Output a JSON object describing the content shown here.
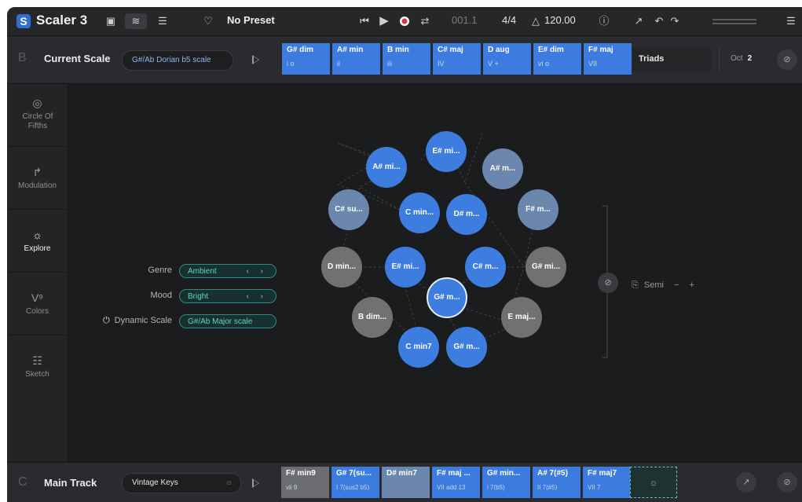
{
  "app": {
    "logo_letter": "S",
    "title": "Scaler 3"
  },
  "topbar": {
    "preset_label": "No Preset",
    "position": "001.1",
    "time_signature": "4/4",
    "tempo": "120.00"
  },
  "scale_row": {
    "letter": "B",
    "title": "Current Scale",
    "scale_name": "G#/Ab Dorian b5 scale",
    "chords": [
      {
        "name": "G# dim",
        "roman": "i o"
      },
      {
        "name": "A# min",
        "roman": "ii"
      },
      {
        "name": "B min",
        "roman": "iii"
      },
      {
        "name": "C# maj",
        "roman": "IV"
      },
      {
        "name": "D aug",
        "roman": "V +"
      },
      {
        "name": "E# dim",
        "roman": "vi o"
      },
      {
        "name": "F# maj",
        "roman": "VII"
      }
    ],
    "chord_type": "Triads",
    "oct_label": "Oct",
    "oct_value": "2"
  },
  "sidebar": {
    "items": [
      {
        "label": "Circle Of Fifths",
        "icon": "target-icon"
      },
      {
        "label": "Modulation",
        "icon": "modulation-icon"
      },
      {
        "label": "Explore",
        "icon": "lightbulb-icon"
      },
      {
        "label": "Colors",
        "icon": "colors-icon"
      },
      {
        "label": "Sketch",
        "icon": "sketch-icon"
      }
    ]
  },
  "explore": {
    "genre_label": "Genre",
    "genre_value": "Ambient",
    "mood_label": "Mood",
    "mood_value": "Bright",
    "dynamic_label": "Dynamic Scale",
    "dynamic_value": "G#/Ab Major scale",
    "semi_label": "Semi",
    "nodes": [
      {
        "label": "E# mi...",
        "color": "blue"
      },
      {
        "label": "A# mi...",
        "color": "blue"
      },
      {
        "label": "A# m...",
        "color": "slate"
      },
      {
        "label": "C# su...",
        "color": "slate"
      },
      {
        "label": "C min...",
        "color": "blue"
      },
      {
        "label": "D# m...",
        "color": "blue"
      },
      {
        "label": "F# m...",
        "color": "slate"
      },
      {
        "label": "D min...",
        "color": "grey"
      },
      {
        "label": "E# mi...",
        "color": "blue"
      },
      {
        "label": "C# m...",
        "color": "blue"
      },
      {
        "label": "G# mi...",
        "color": "grey"
      },
      {
        "label": "G# m...",
        "color": "selected"
      },
      {
        "label": "B dim...",
        "color": "grey"
      },
      {
        "label": "E maj...",
        "color": "grey"
      },
      {
        "label": "C min7",
        "color": "blue"
      },
      {
        "label": "G# m...",
        "color": "blue"
      }
    ]
  },
  "track_row": {
    "letter": "C",
    "title": "Main Track",
    "instrument": "Vintage Keys",
    "chords": [
      {
        "name": "F# min9",
        "roman": "vii 9",
        "color": "grey"
      },
      {
        "name": "G# 7(su...",
        "roman": "I 7(sus2 b5)",
        "color": "blue"
      },
      {
        "name": "D# min7",
        "roman": "",
        "color": "slate"
      },
      {
        "name": "F# maj ...",
        "roman": "VII add 13",
        "color": "blue"
      },
      {
        "name": "G# min...",
        "roman": "i 7(b5)",
        "color": "blue"
      },
      {
        "name": "A# 7(#5)",
        "roman": "II 7(#5)",
        "color": "blue"
      },
      {
        "name": "F# maj7",
        "roman": "VII 7",
        "color": "blue"
      }
    ]
  }
}
